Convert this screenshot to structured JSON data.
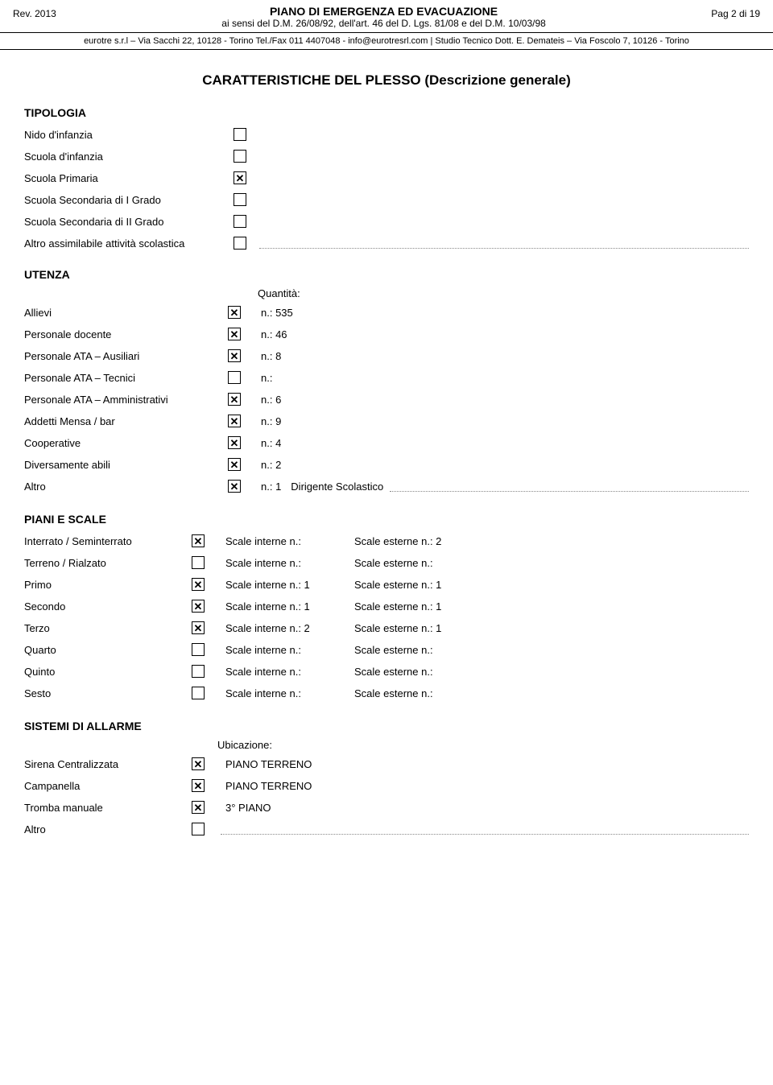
{
  "header": {
    "rev": "Rev. 2013",
    "title_main": "PIANO DI EMERGENZA ED EVACUAZIONE",
    "title_sub": "ai sensi del D.M. 26/08/92, dell'art. 46 del D. Lgs. 81/08 e del D.M. 10/03/98",
    "page": "Pag 2 di 19",
    "subheader": "eurotre s.r.l – Via Sacchi 22, 10128 - Torino  Tel./Fax 011 4407048 - info@eurotresrl.com  |  Studio Tecnico Dott. E. Demateis – Via Foscolo 7, 10126 - Torino"
  },
  "page_title": "CARATTERISTICHE DEL PLESSO (Descrizione generale)",
  "tipologia": {
    "section_label": "TIPOLOGIA",
    "items": [
      {
        "label": "Nido d'infanzia",
        "checked": false
      },
      {
        "label": "Scuola d'infanzia",
        "checked": false
      },
      {
        "label": "Scuola Primaria",
        "checked": true
      },
      {
        "label": "Scuola Secondaria di I Grado",
        "checked": false
      },
      {
        "label": "Scuola Secondaria di II Grado",
        "checked": false
      },
      {
        "label": "Altro assimilabile attività scolastica",
        "checked": false,
        "dotted": true
      }
    ]
  },
  "utenza": {
    "section_label": "UTENZA",
    "qty_header": "Quantità:",
    "items": [
      {
        "label": "Allievi",
        "checked": true,
        "qty": "n.: 535"
      },
      {
        "label": "Personale docente",
        "checked": true,
        "qty": "n.: 46"
      },
      {
        "label": "Personale ATA – Ausiliari",
        "checked": true,
        "qty": "n.: 8"
      },
      {
        "label": "Personale ATA – Tecnici",
        "checked": false,
        "qty": "n.:"
      },
      {
        "label": "Personale ATA – Amministrativi",
        "checked": true,
        "qty": "n.: 6"
      },
      {
        "label": "Addetti Mensa / bar",
        "checked": true,
        "qty": "n.: 9"
      },
      {
        "label": "Cooperative",
        "checked": true,
        "qty": "n.: 4"
      },
      {
        "label": "Diversamente abili",
        "checked": true,
        "qty": "n.: 2"
      },
      {
        "label": "Altro",
        "checked": true,
        "qty": "n.: 1",
        "extra": "Dirigente Scolastico"
      }
    ]
  },
  "piani_e_scale": {
    "section_label": "PIANI E SCALE",
    "items": [
      {
        "label": "Interrato / Seminterrato",
        "checked": true,
        "scale_int": "Scale interne n.:",
        "scale_est": "Scale esterne n.: 2"
      },
      {
        "label": "Terreno / Rialzato",
        "checked": false,
        "scale_int": "Scale interne n.:",
        "scale_est": "Scale esterne n.:"
      },
      {
        "label": "Primo",
        "checked": true,
        "scale_int": "Scale interne n.: 1",
        "scale_est": "Scale esterne n.: 1"
      },
      {
        "label": "Secondo",
        "checked": true,
        "scale_int": "Scale interne n.: 1",
        "scale_est": "Scale esterne n.: 1"
      },
      {
        "label": "Terzo",
        "checked": true,
        "scale_int": "Scale interne n.: 2",
        "scale_est": "Scale esterne n.: 1"
      },
      {
        "label": "Quarto",
        "checked": false,
        "scale_int": "Scale interne n.:",
        "scale_est": "Scale esterne n.:"
      },
      {
        "label": "Quinto",
        "checked": false,
        "scale_int": "Scale interne n.:",
        "scale_est": "Scale esterne n.:"
      },
      {
        "label": "Sesto",
        "checked": false,
        "scale_int": "Scale interne n.:",
        "scale_est": "Scale esterne n.:"
      }
    ]
  },
  "sistemi_di_allarme": {
    "section_label": "SISTEMI DI ALLARME",
    "ubicazione_header": "Ubicazione:",
    "items": [
      {
        "label": "Sirena Centralizzata",
        "checked": true,
        "ubicazione": "PIANO TERRENO"
      },
      {
        "label": "Campanella",
        "checked": true,
        "ubicazione": " PIANO TERRENO"
      },
      {
        "label": "Tromba manuale",
        "checked": true,
        "ubicazione": "3° PIANO"
      },
      {
        "label": "Altro",
        "checked": false,
        "ubicazione": "",
        "dotted": true
      }
    ]
  }
}
